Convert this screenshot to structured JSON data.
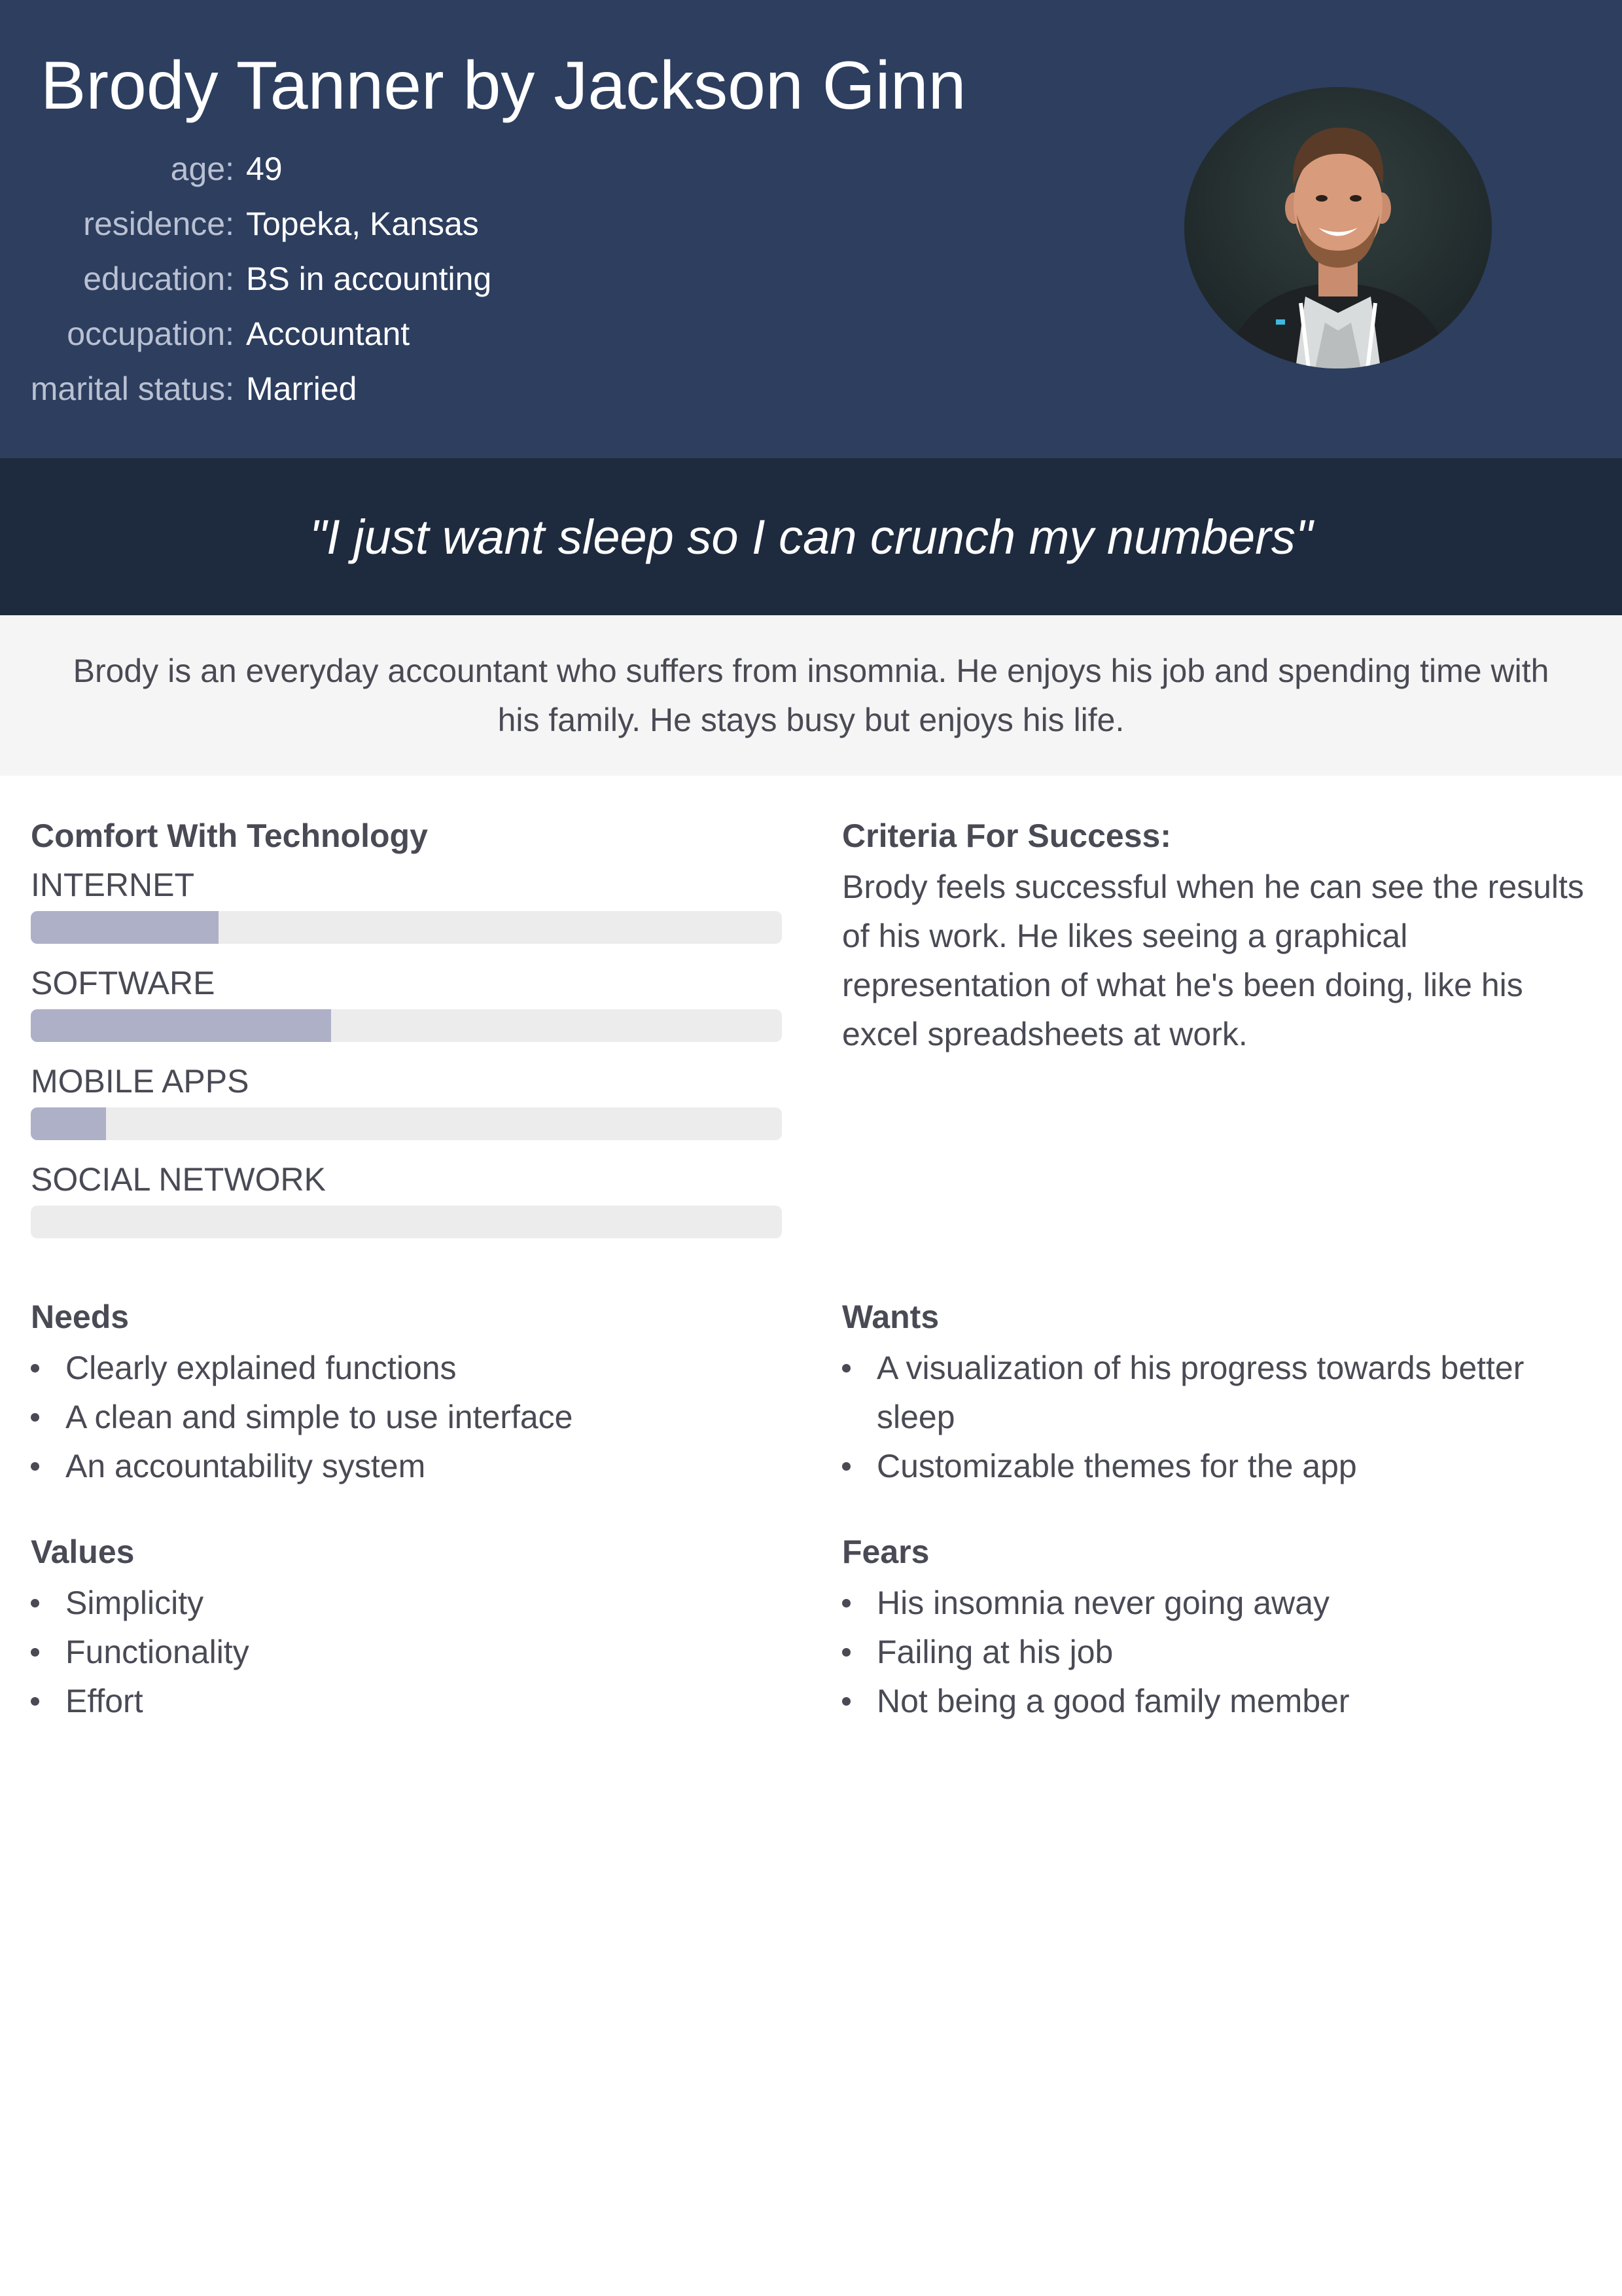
{
  "persona": {
    "title": "Brody Tanner by Jackson Ginn",
    "attributes": [
      {
        "label": "age:",
        "value": "49"
      },
      {
        "label": "residence:",
        "value": "Topeka, Kansas"
      },
      {
        "label": "education:",
        "value": "BS in accounting"
      },
      {
        "label": "occupation:",
        "value": "Accountant"
      },
      {
        "label": "marital status:",
        "value": "Married"
      }
    ]
  },
  "quote": "\"I just want sleep so I can crunch my numbers\"",
  "bio": "Brody is an everyday accountant who suffers from insomnia. He enjoys his job and spending time with his family. He stays busy but enjoys his life.",
  "comfort": {
    "title": "Comfort With Technology",
    "items": [
      {
        "label": "INTERNET",
        "level": 0.25
      },
      {
        "label": "SOFTWARE",
        "level": 0.4
      },
      {
        "label": "MOBILE APPS",
        "level": 0.1
      },
      {
        "label": "SOCIAL NETWORK",
        "level": 0.0
      }
    ]
  },
  "criteria": {
    "title": "Criteria For Success:",
    "text": "Brody feels successful when he can see the results of his work. He likes seeing a graphical representation of what he's been doing, like his excel spreadsheets at work."
  },
  "needs": {
    "title": "Needs",
    "items": [
      "Clearly explained functions",
      "A clean and simple to use interface",
      "An accountability system"
    ]
  },
  "wants": {
    "title": "Wants",
    "items": [
      "A visualization of his progress towards better sleep",
      "Customizable themes for the app"
    ]
  },
  "values": {
    "title": "Values",
    "items": [
      "Simplicity",
      "Functionality",
      "Effort"
    ]
  },
  "fears": {
    "title": "Fears",
    "items": [
      "His insomnia never going away",
      "Failing at his job",
      "Not being a good family member"
    ]
  },
  "colors": {
    "header_bg": "#2d3e5f",
    "quote_bg": "#1e2a3e",
    "bio_bg": "#f5f5f5",
    "bar_fill": "#aeb0c8",
    "bar_track": "#ececec"
  }
}
